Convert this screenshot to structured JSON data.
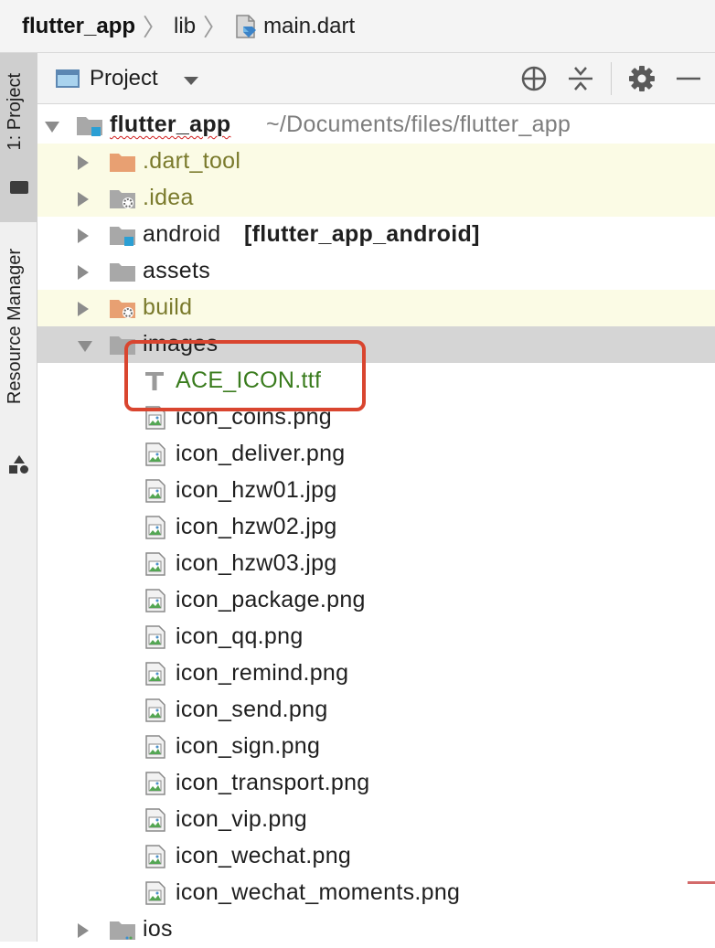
{
  "breadcrumb": {
    "project": "flutter_app",
    "folder": "lib",
    "file": "main.dart"
  },
  "side_strip": {
    "project_tab": "1: Project",
    "resource_tab": "Resource Manager"
  },
  "project_panel": {
    "title": "Project",
    "icons": [
      "crosshair-icon",
      "collapse-all-icon",
      "gear-icon",
      "minimize-icon"
    ]
  },
  "tree": {
    "root": {
      "name": "flutter_app",
      "path": "~/Documents/files/flutter_app"
    },
    "dart_tool": ".dart_tool",
    "idea": ".idea",
    "android": {
      "name": "android",
      "module": "[flutter_app_android]"
    },
    "assets": "assets",
    "build": "build",
    "images": "images",
    "image_files": [
      "ACE_ICON.ttf",
      "icon_coins.png",
      "icon_deliver.png",
      "icon_hzw01.jpg",
      "icon_hzw02.jpg",
      "icon_hzw03.jpg",
      "icon_package.png",
      "icon_qq.png",
      "icon_remind.png",
      "icon_send.png",
      "icon_sign.png",
      "icon_transport.png",
      "icon_vip.png",
      "icon_wechat.png",
      "icon_wechat_moments.png"
    ],
    "ios": "ios"
  },
  "colors": {
    "highlight_box": "#d9452f",
    "excluded_folder_bg": "#fbfbe5",
    "selected_row_bg": "#d5d5d5",
    "new_file_text": "#3a7c1e",
    "excluded_text": "#7a7a2c"
  }
}
